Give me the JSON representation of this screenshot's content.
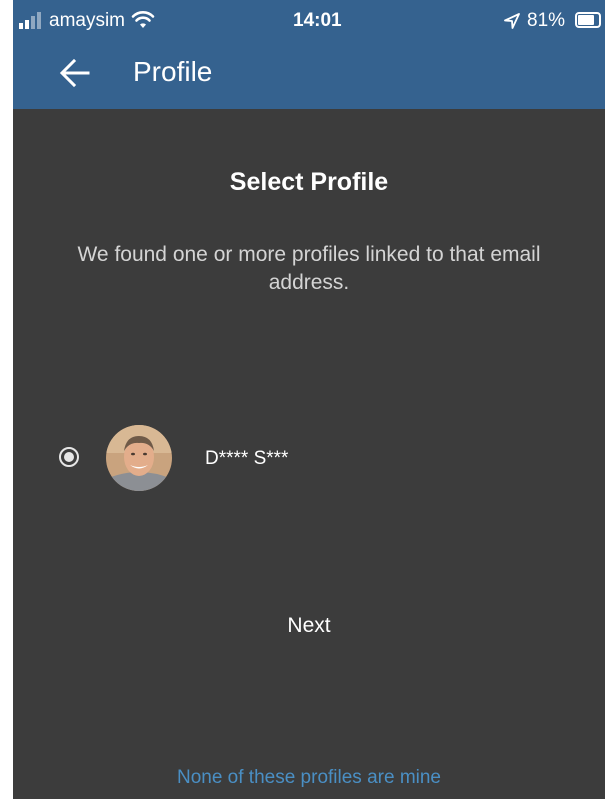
{
  "status_bar": {
    "carrier": "amaysim",
    "time": "14:01",
    "battery_percent": "81%"
  },
  "header": {
    "title": "Profile"
  },
  "main": {
    "heading": "Select Profile",
    "description": "We found one or more profiles linked to that email address.",
    "profiles": [
      {
        "name": "D**** S***",
        "selected": true
      }
    ],
    "next_label": "Next",
    "none_link": "None of these profiles are mine"
  },
  "colors": {
    "header_bg": "#35628f",
    "content_bg": "#3c3c3c",
    "link": "#4a8fc4"
  },
  "icons": {
    "back": "arrow-left-icon",
    "signal": "cellular-signal-icon",
    "wifi": "wifi-icon",
    "location": "location-arrow-icon",
    "battery": "battery-icon"
  }
}
